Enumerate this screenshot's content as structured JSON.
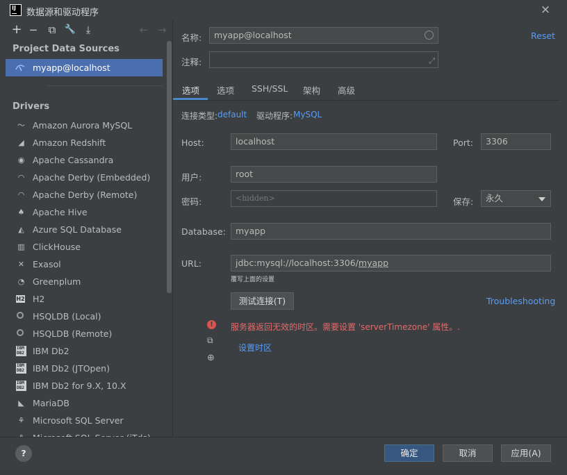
{
  "window": {
    "title": "数据源和驱动程序",
    "close_icon": "×"
  },
  "left_toolbar": {
    "add": "+",
    "remove": "−",
    "duplicate": "⧉",
    "settings": "🔧",
    "import": "⤓",
    "back": "←",
    "forward": "→"
  },
  "project_section": {
    "title": "Project Data Sources",
    "items": [
      {
        "label": "myapp@localhost",
        "icon": "mysql-icon"
      }
    ]
  },
  "drivers_section": {
    "title": "Drivers",
    "items": [
      {
        "label": "Amazon Aurora MySQL",
        "icon": "dolphin-icon",
        "glyph": "〜"
      },
      {
        "label": "Amazon Redshift",
        "icon": "redshift-icon",
        "glyph": "◢"
      },
      {
        "label": "Apache Cassandra",
        "icon": "cassandra-icon",
        "glyph": "◉"
      },
      {
        "label": "Apache Derby (Embedded)",
        "icon": "derby-icon",
        "glyph": "◠"
      },
      {
        "label": "Apache Derby (Remote)",
        "icon": "derby-icon",
        "glyph": "◠"
      },
      {
        "label": "Apache Hive",
        "icon": "hive-icon",
        "glyph": "♠"
      },
      {
        "label": "Azure SQL Database",
        "icon": "azure-icon",
        "glyph": "◭"
      },
      {
        "label": "ClickHouse",
        "icon": "clickhouse-icon",
        "glyph": "▥"
      },
      {
        "label": "Exasol",
        "icon": "exasol-icon",
        "glyph": "✕"
      },
      {
        "label": "Greenplum",
        "icon": "greenplum-icon",
        "glyph": "◔"
      },
      {
        "label": "H2",
        "icon": "h2-icon",
        "glyph": "H2"
      },
      {
        "label": "HSQLDB (Local)",
        "icon": "hsqldb-icon",
        "glyph": ""
      },
      {
        "label": "HSQLDB (Remote)",
        "icon": "hsqldb-icon",
        "glyph": ""
      },
      {
        "label": "IBM Db2",
        "icon": "ibm-db2-icon",
        "glyph": "IBM DB2"
      },
      {
        "label": "IBM Db2 (JTOpen)",
        "icon": "ibm-db2-icon",
        "glyph": "IBM DB2"
      },
      {
        "label": "IBM Db2 for 9.X, 10.X",
        "icon": "ibm-db2-icon",
        "glyph": "IBM DB2"
      },
      {
        "label": "MariaDB",
        "icon": "mariadb-icon",
        "glyph": "◣"
      },
      {
        "label": "Microsoft SQL Server",
        "icon": "sql-server-icon",
        "glyph": "⚘"
      },
      {
        "label": "Microsoft SQL Server (jTds)",
        "icon": "sql-server-icon",
        "glyph": "⚘"
      }
    ]
  },
  "form": {
    "reset": "Reset",
    "name_label": "名称:",
    "name_value": "myapp@localhost",
    "comment_label": "注释:",
    "comment_value": "",
    "expand_icon": "⤢",
    "tabs": [
      "选项",
      "选项",
      "SSH/SSL",
      "架构",
      "高级"
    ],
    "connection_type_label": "连接类型:",
    "connection_type_value": "default",
    "driver_label": "驱动程序:",
    "driver_value": "MySQL",
    "host_label": "Host:",
    "host_value": "localhost",
    "port_label": "Port:",
    "port_value": "3306",
    "user_label": "用户:",
    "user_value": "root",
    "password_label": "密码:",
    "password_placeholder": "<hidden>",
    "save_label": "保存:",
    "save_value": "永久",
    "database_label": "Database:",
    "database_value": "myapp",
    "url_label": "URL:",
    "url_prefix": "jdbc:mysql://localhost:3306/",
    "url_db": "myapp",
    "url_hint": "覆写上面的设置",
    "test_button": "测试连接(T)",
    "troubleshooting": "Troubleshooting",
    "error_icon": "!",
    "error_message": "服务器返回无效的时区。需要设置 'serverTimezone' 属性。.",
    "copy_icon": "⧉",
    "set_timezone": "设置时区",
    "globe_icon": "⊕"
  },
  "footer": {
    "help": "?",
    "ok": "确定",
    "cancel": "取消",
    "apply": "应用(A)"
  },
  "colors": {
    "accent": "#4b6eaf",
    "link": "#589df6",
    "error": "#e46a6a",
    "bg": "#3c3f41"
  }
}
